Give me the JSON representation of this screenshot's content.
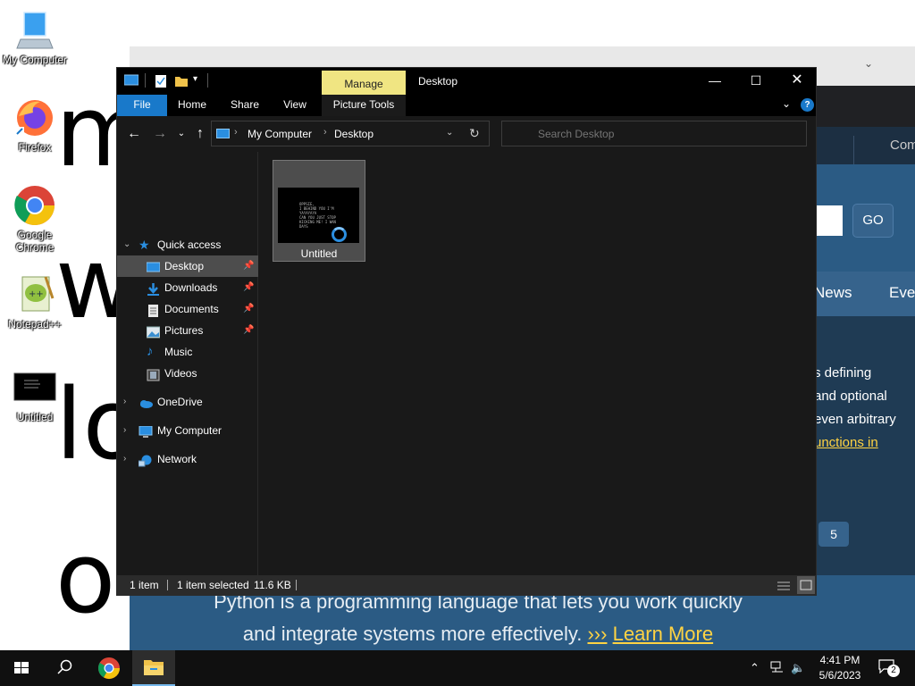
{
  "desktop": {
    "bg_letters": [
      "m",
      "w",
      "lo",
      "o"
    ],
    "icons": [
      {
        "label": "My Computer",
        "icon": "monitor-icon"
      },
      {
        "label": "Firefox",
        "icon": "firefox-icon"
      },
      {
        "label": "Google Chrome",
        "icon": "chrome-icon"
      },
      {
        "label": "Notepad++",
        "icon": "notepadpp-icon"
      },
      {
        "label": "Untitled",
        "icon": "image-file-icon"
      }
    ]
  },
  "browser": {
    "go_label": "GO",
    "tab_com": "Com",
    "nav_news": "News",
    "nav_eve": "Eve",
    "content_lines": [
      "s defining",
      "and optional",
      "even arbitrary"
    ],
    "content_link": "unctions in",
    "page_button": "5",
    "tagline_line1": "Python is a programming language that lets you work quickly",
    "tagline_line2": "and integrate systems more effectively.",
    "tagline_arrows": "›››",
    "learn_more": "Learn More"
  },
  "explorer": {
    "manage_tab": "Manage",
    "title": "Desktop",
    "ribbon_tabs": {
      "file": "File",
      "home": "Home",
      "share": "Share",
      "view": "View",
      "picture_tools": "Picture Tools"
    },
    "help": "?",
    "address": {
      "root": "My Computer",
      "current": "Desktop"
    },
    "search_placeholder": "Search Desktop",
    "nav": {
      "quick_access": "Quick access",
      "desktop": "Desktop",
      "downloads": "Downloads",
      "documents": "Documents",
      "pictures": "Pictures",
      "music": "Music",
      "videos": "Videos",
      "onedrive": "OneDrive",
      "my_computer": "My Computer",
      "network": "Network"
    },
    "files": [
      {
        "name": "Untitled",
        "thumb_text": "OPPSIE,\nI BEHIND YOU I'M\nYAYAYAYA\nCAN YOU JUST STOP\nKICKING ME! I WAN\nDAYS"
      }
    ],
    "status": {
      "count": "1 item",
      "selected": "1 item selected",
      "size": "11.6 KB"
    }
  },
  "taskbar": {
    "time": "4:41 PM",
    "date": "5/6/2023",
    "notification_count": "2"
  },
  "colors": {
    "accent": "#1979ca",
    "manage_tab": "#f0e582",
    "python_blue": "#2b5b84",
    "python_yellow": "#ffd343"
  }
}
